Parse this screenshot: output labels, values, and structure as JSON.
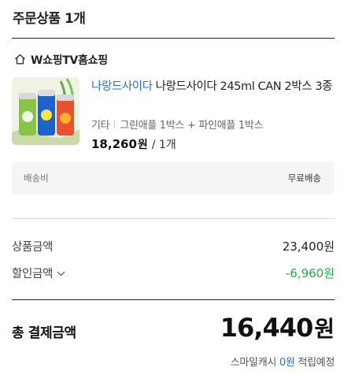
{
  "section": {
    "title": "주문상품 1개"
  },
  "seller": {
    "name": "W쇼핑TV홈쇼핑",
    "icon": "home-icon"
  },
  "product": {
    "brand": "나랑드사이다",
    "name": "나랑드사이다 245ml CAN 2박스 3종",
    "option_type": "기타",
    "option_value": "그린애플 1박스 + 파인애플 1박스",
    "price": "18,260",
    "price_unit": "원",
    "quantity": "/ 1개"
  },
  "shipping": {
    "label": "배송비",
    "value": "무료배송"
  },
  "summary": {
    "product_amount_label": "상품금액",
    "product_amount_value": "23,400원",
    "discount_label": "할인금액",
    "discount_value": "-6,960원"
  },
  "total": {
    "label": "총 결제금액",
    "amount": "16,440",
    "unit": "원"
  },
  "points": {
    "prefix": "스마일캐시",
    "value": "0원",
    "suffix": "적립예정"
  },
  "colors": {
    "brand_blue": "#2e6fd8",
    "discount_green": "#2aa84a"
  }
}
